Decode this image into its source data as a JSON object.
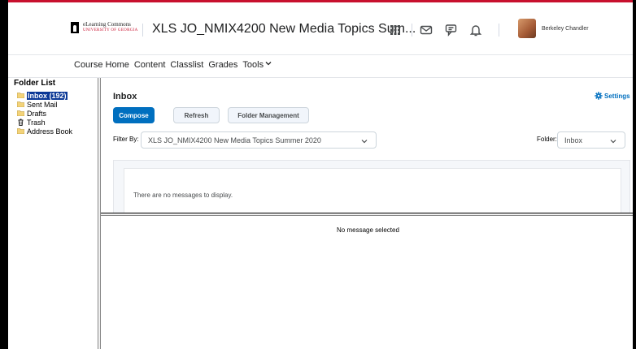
{
  "header": {
    "logo_line1": "eLearning Commons",
    "logo_line2": "UNIVERSITY OF GEORGIA",
    "course_title": "XLS JO_NMIX4200 New Media Topics Sum...",
    "user_name": "Berkeley Chandler",
    "icons": [
      "apps-grid-icon",
      "mail-icon",
      "chat-icon",
      "bell-icon"
    ]
  },
  "nav": {
    "items": [
      "Course Home",
      "Content",
      "Classlist",
      "Grades",
      "Tools"
    ]
  },
  "folders": {
    "heading": "Folder List",
    "items": [
      {
        "label": "Inbox (192)",
        "icon": "folder-icon",
        "active": true
      },
      {
        "label": "Sent Mail",
        "icon": "folder-icon",
        "active": false
      },
      {
        "label": "Drafts",
        "icon": "folder-icon",
        "active": false
      },
      {
        "label": "Trash",
        "icon": "trash-icon",
        "active": false
      },
      {
        "label": "Address Book",
        "icon": "folder-icon",
        "active": false
      }
    ]
  },
  "inbox": {
    "title": "Inbox",
    "settings_label": "Settings",
    "buttons": {
      "compose": "Compose",
      "refresh": "Refresh",
      "folder_management": "Folder Management"
    },
    "filter_label": "Filter By:",
    "filter_value": "XLS JO_NMIX4200 New Media Topics Summer 2020",
    "folder_label": "Folder:",
    "folder_value": "Inbox",
    "empty_message": "There are no messages to display."
  },
  "preview": {
    "empty_message": "No message selected"
  },
  "colors": {
    "brand_red": "#c8102e",
    "primary_blue": "#006fbf",
    "selection_blue": "#0b3896"
  }
}
